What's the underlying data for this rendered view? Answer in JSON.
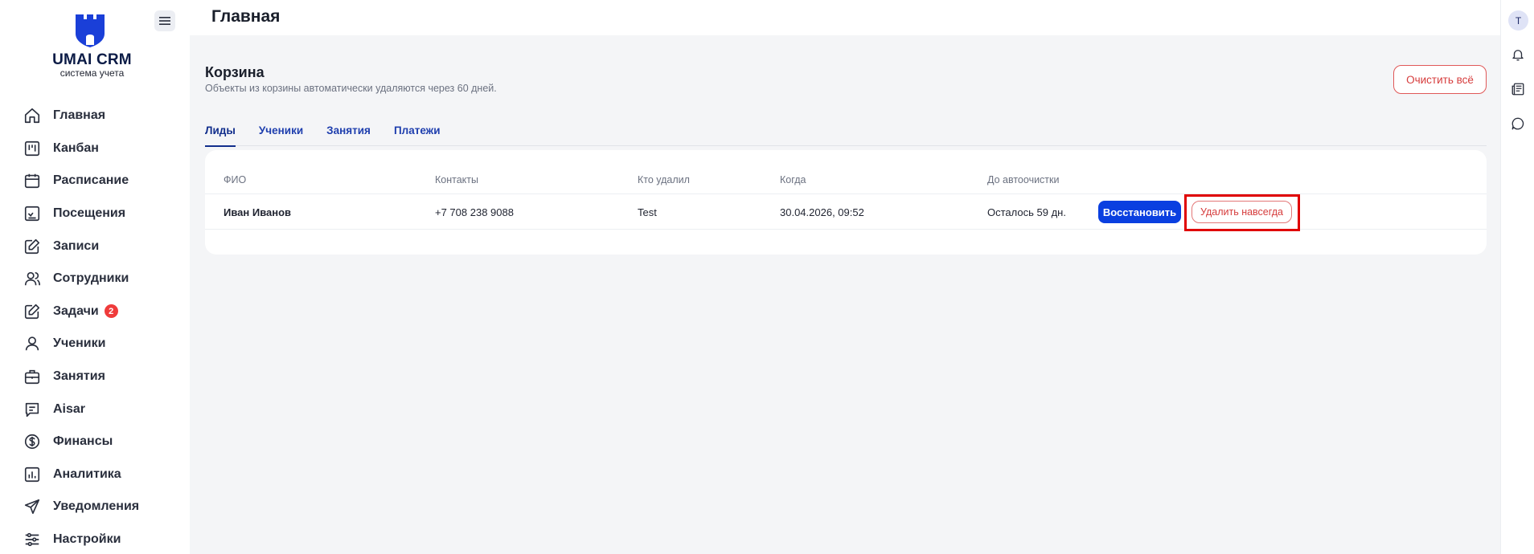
{
  "brand": {
    "name": "UMAI CRM",
    "subtitle": "система учета",
    "logo_color": "#1a3fd8"
  },
  "header": {
    "title": "Главная"
  },
  "sidebar": {
    "items": [
      {
        "label": "Главная",
        "icon": "home-icon"
      },
      {
        "label": "Канбан",
        "icon": "kanban-icon"
      },
      {
        "label": "Расписание",
        "icon": "calendar-icon"
      },
      {
        "label": "Посещения",
        "icon": "attendance-icon"
      },
      {
        "label": "Записи",
        "icon": "edit-icon"
      },
      {
        "label": "Сотрудники",
        "icon": "staff-icon"
      },
      {
        "label": "Задачи",
        "icon": "tasks-icon",
        "badge": "2"
      },
      {
        "label": "Ученики",
        "icon": "user-icon"
      },
      {
        "label": "Занятия",
        "icon": "briefcase-icon"
      },
      {
        "label": "Aisar",
        "icon": "chat-icon"
      },
      {
        "label": "Финансы",
        "icon": "dollar-icon"
      },
      {
        "label": "Аналитика",
        "icon": "analytics-icon"
      },
      {
        "label": "Уведомления",
        "icon": "send-icon"
      },
      {
        "label": "Настройки",
        "icon": "settings-icon"
      }
    ]
  },
  "trash": {
    "title": "Корзина",
    "description": "Объекты из корзины автоматически удаляются через 60 дней.",
    "clear_all_label": "Очистить всё",
    "tabs": [
      "Лиды",
      "Ученики",
      "Занятия",
      "Платежи"
    ],
    "active_tab": "Лиды",
    "columns": {
      "name": "ФИО",
      "contacts": "Контакты",
      "deleted_by": "Кто удалил",
      "when": "Когда",
      "until_cleanup": "До автоочистки"
    },
    "rows": [
      {
        "name": "Иван Иванов",
        "contacts": "+7 708 238 9088",
        "deleted_by": "Test",
        "when": "30.04.2026, 09:52",
        "until_cleanup": "Осталось 59 дн.",
        "restore_label": "Восстановить",
        "delete_label": "Удалить навсегда"
      }
    ]
  },
  "right_rail": {
    "avatar_initial": "Т",
    "icons": [
      "bell-icon",
      "news-icon",
      "message-icon"
    ]
  },
  "colors": {
    "primary": "#0a3fe0",
    "danger": "#d63c3c",
    "badge": "#ef3b3b",
    "highlight": "#e00000"
  }
}
